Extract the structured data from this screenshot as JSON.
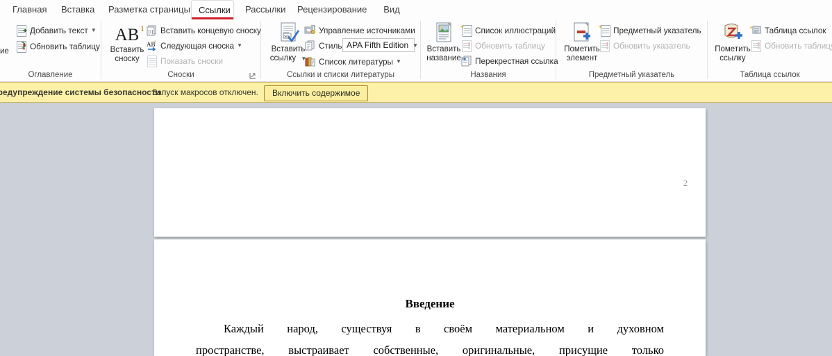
{
  "app": {
    "accent_red": "#cf1d24",
    "ribbon_bg": "#fdfdfd",
    "canvas_bg": "#ccd0d8"
  },
  "ribbon": {
    "tabs": [
      {
        "label": "Главная",
        "active": false
      },
      {
        "label": "Вставка",
        "active": false
      },
      {
        "label": "Разметка страницы",
        "active": false
      },
      {
        "label": "Ссылки",
        "active": true
      },
      {
        "label": "Рассылки",
        "active": false
      },
      {
        "label": "Рецензирование",
        "active": false
      },
      {
        "label": "Вид",
        "active": false
      }
    ],
    "left_clipped_text": "ие",
    "groups": [
      {
        "name": "Оглавление",
        "items": [
          {
            "label": "Добавить текст",
            "icon": "add-text-icon",
            "caret": true,
            "disabled": false
          },
          {
            "label": "Обновить таблицу",
            "icon": "update-table-icon",
            "caret": false,
            "disabled": false
          }
        ]
      },
      {
        "name": "Сноски",
        "big": {
          "label_line1": "Вставить",
          "label_line2": "сноску",
          "icon": "insert-footnote-icon"
        },
        "items": [
          {
            "label": "Вставить концевую сноску",
            "icon": "insert-endnote-icon",
            "caret": false,
            "disabled": false
          },
          {
            "label": "Следующая сноска",
            "icon": "next-footnote-icon",
            "caret": true,
            "disabled": false
          },
          {
            "label": "Показать сноски",
            "icon": "show-footnotes-icon",
            "caret": false,
            "disabled": true
          }
        ],
        "has_dialog_launcher": true
      },
      {
        "name": "Ссылки и списки литературы",
        "big": {
          "label_line1": "Вставить",
          "label_line2": "ссылку",
          "icon": "insert-citation-icon",
          "caret": true
        },
        "items": [
          {
            "label": "Управление источниками",
            "icon": "manage-sources-icon",
            "caret": false,
            "disabled": false
          },
          {
            "label": "Список литературы",
            "icon": "bibliography-icon",
            "caret": true,
            "disabled": false
          }
        ],
        "style_label": "Стиль:",
        "style_value": "APA Fifth Edition"
      },
      {
        "name": "Названия",
        "big": {
          "label_line1": "Вставить",
          "label_line2": "название",
          "icon": "insert-caption-icon"
        },
        "items": [
          {
            "label": "Список иллюстраций",
            "icon": "table-of-figures-icon",
            "caret": false,
            "disabled": false
          },
          {
            "label": "Обновить таблицу",
            "icon": "update-table-icon",
            "caret": false,
            "disabled": true
          },
          {
            "label": "Перекрестная ссылка",
            "icon": "cross-reference-icon",
            "caret": false,
            "disabled": false
          }
        ]
      },
      {
        "name": "Предметный указатель",
        "big": {
          "label_line1": "Пометить",
          "label_line2": "элемент",
          "icon": "mark-entry-icon"
        },
        "items": [
          {
            "label": "Предметный указатель",
            "icon": "insert-index-icon",
            "caret": false,
            "disabled": false
          },
          {
            "label": "Обновить указатель",
            "icon": "update-index-icon",
            "caret": false,
            "disabled": true
          }
        ]
      },
      {
        "name": "Таблица ссылок",
        "big": {
          "label_line1": "Пометить",
          "label_line2": "ссылку",
          "icon": "mark-citation-icon"
        },
        "items": [
          {
            "label": "Таблица ссылок",
            "icon": "insert-authorities-icon",
            "caret": false,
            "disabled": false
          },
          {
            "label": "Обновить таблицу",
            "icon": "update-table-icon",
            "caret": false,
            "disabled": true
          }
        ]
      }
    ]
  },
  "security_bar": {
    "title": "Предупреждение системы безопасности",
    "message": "Запуск макросов отключен.",
    "button": "Включить содержимое",
    "background": "#fdf0a8",
    "border": "#c8b560"
  },
  "document": {
    "page1": {
      "page_number": "2"
    },
    "page2": {
      "heading": "Введение",
      "paragraph_lines": [
        "Каждый народ, существуя в своём материальном и духовном",
        "пространстве, выстраивает собственные, оригинальные, присущие только"
      ]
    }
  }
}
